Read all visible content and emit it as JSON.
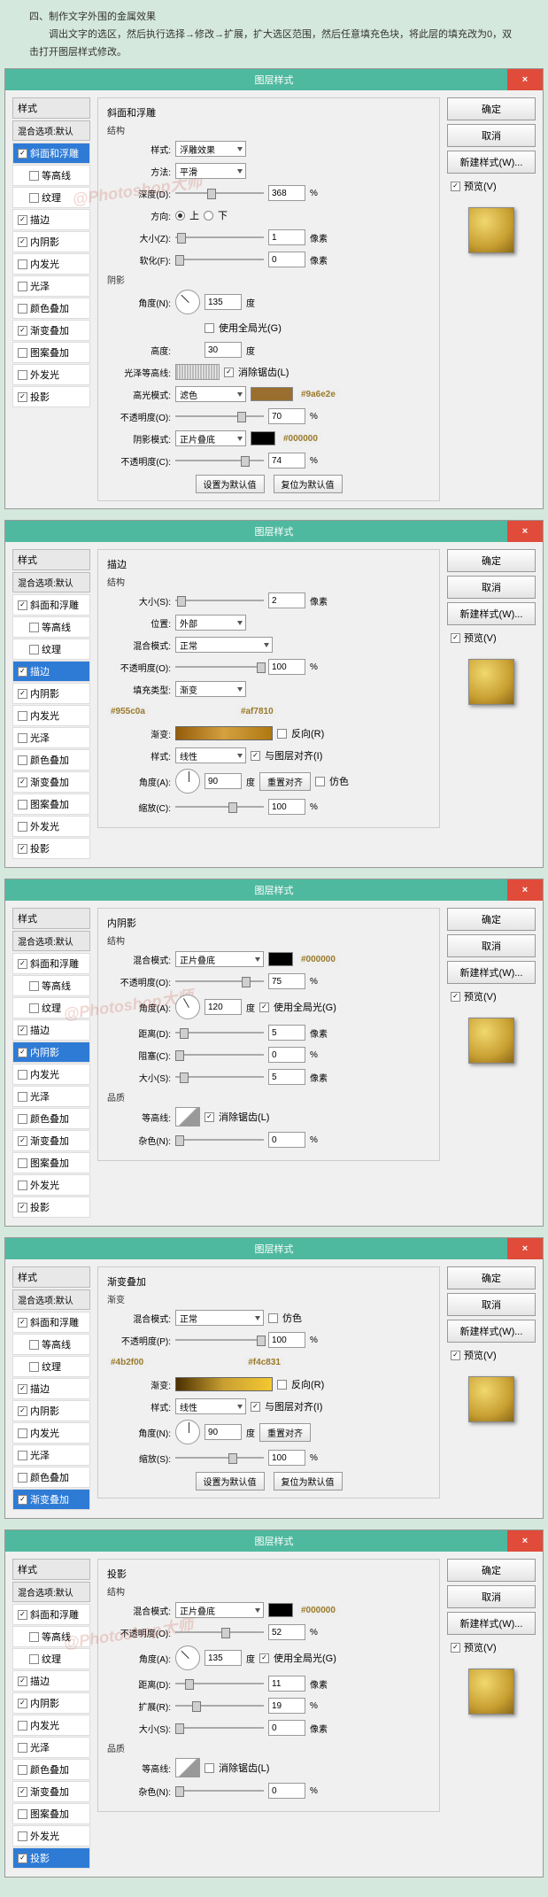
{
  "intro": {
    "title": "四、制作文字外围的金属效果",
    "desc": "调出文字的选区，然后执行选择→修改→扩展，扩大选区范围，然后任意填充色块，将此层的填充改为0，双击打开图层样式修改。"
  },
  "common": {
    "dialog_title": "图层样式",
    "ok": "确定",
    "cancel": "取消",
    "new_style": "新建样式(W)...",
    "preview": "预览(V)",
    "styles_h": "样式",
    "blend_def": "混合选项:默认",
    "set_default": "设置为默认值",
    "reset_default": "复位为默认值",
    "close": "×"
  },
  "style_names": {
    "bevel": "斜面和浮雕",
    "contour_s": "等高线",
    "texture": "纹理",
    "stroke": "描边",
    "inner_shadow": "内阴影",
    "inner_glow": "内发光",
    "satin": "光泽",
    "color_overlay": "颜色叠加",
    "grad_overlay": "渐变叠加",
    "pattern_overlay": "图案叠加",
    "outer_glow": "外发光",
    "drop_shadow": "投影"
  },
  "d1": {
    "section": "斜面和浮雕",
    "struct": "结构",
    "style_l": "样式:",
    "style_v": "浮雕效果",
    "method_l": "方法:",
    "method_v": "平滑",
    "depth_l": "深度(D):",
    "depth_v": "368",
    "pct": "%",
    "dir_l": "方向:",
    "up": "上",
    "down": "下",
    "size_l": "大小(Z):",
    "size_v": "1",
    "px": "像素",
    "soft_l": "软化(F):",
    "soft_v": "0",
    "shade": "阴影",
    "angle_l": "角度(N):",
    "angle_v": "135",
    "deg": "度",
    "global": "使用全局光(G)",
    "alt_l": "高度:",
    "alt_v": "30",
    "gloss_l": "光泽等高线:",
    "aa": "消除锯齿(L)",
    "hmode_l": "高光模式:",
    "hmode_v": "滤色",
    "hcolor": "#9a6e2e",
    "hopac_l": "不透明度(O):",
    "hopac_v": "70",
    "smode_l": "阴影模式:",
    "smode_v": "正片叠底",
    "scolor": "#000000",
    "sopac_l": "不透明度(C):",
    "sopac_v": "74"
  },
  "d2": {
    "section": "描边",
    "struct": "结构",
    "size_l": "大小(S):",
    "size_v": "2",
    "px": "像素",
    "pos_l": "位置:",
    "pos_v": "外部",
    "blend_l": "混合模式:",
    "blend_v": "正常",
    "opac_l": "不透明度(O):",
    "opac_v": "100",
    "pct": "%",
    "fill_l": "填充类型:",
    "fill_v": "渐变",
    "c1": "#955c0a",
    "c2": "#af7810",
    "grad_l": "渐变:",
    "reverse": "反向(R)",
    "gstyle_l": "样式:",
    "gstyle_v": "线性",
    "align": "与图层对齐(I)",
    "angle_l": "角度(A):",
    "angle_v": "90",
    "deg": "度",
    "realign": "重置对齐",
    "dither": "仿色",
    "scale_l": "缩放(C):",
    "scale_v": "100"
  },
  "d3": {
    "section": "内阴影",
    "struct": "结构",
    "blend_l": "混合模式:",
    "blend_v": "正片叠底",
    "color": "#000000",
    "opac_l": "不透明度(O):",
    "opac_v": "75",
    "pct": "%",
    "angle_l": "角度(A):",
    "angle_v": "120",
    "deg": "度",
    "global": "使用全局光(G)",
    "dist_l": "距离(D):",
    "dist_v": "5",
    "px": "像素",
    "choke_l": "阻塞(C):",
    "choke_v": "0",
    "size_l": "大小(S):",
    "size_v": "5",
    "quality": "品质",
    "contour_l": "等高线:",
    "aa": "消除锯齿(L)",
    "noise_l": "杂色(N):",
    "noise_v": "0"
  },
  "d4": {
    "section": "渐变叠加",
    "grad_h": "渐变",
    "blend_l": "混合模式:",
    "blend_v": "正常",
    "dither": "仿色",
    "opac_l": "不透明度(P):",
    "opac_v": "100",
    "pct": "%",
    "c1": "#4b2f00",
    "c2": "#f4c831",
    "grad_l": "渐变:",
    "reverse": "反向(R)",
    "style_l": "样式:",
    "style_v": "线性",
    "align": "与图层对齐(I)",
    "angle_l": "角度(N):",
    "angle_v": "90",
    "deg": "度",
    "realign": "重置对齐",
    "scale_l": "缩放(S):",
    "scale_v": "100"
  },
  "d5": {
    "section": "投影",
    "struct": "结构",
    "blend_l": "混合模式:",
    "blend_v": "正片叠底",
    "color": "#000000",
    "opac_l": "不透明度(O):",
    "opac_v": "52",
    "pct": "%",
    "angle_l": "角度(A):",
    "angle_v": "135",
    "deg": "度",
    "global": "使用全局光(G)",
    "dist_l": "距离(D):",
    "dist_v": "11",
    "px": "像素",
    "spread_l": "扩展(R):",
    "spread_v": "19",
    "size_l": "大小(S):",
    "size_v": "0",
    "quality": "品质",
    "contour_l": "等高线:",
    "aa": "消除锯齿(L)",
    "noise_l": "杂色(N):",
    "noise_v": "0"
  },
  "watermark": "@Photoshop大师"
}
